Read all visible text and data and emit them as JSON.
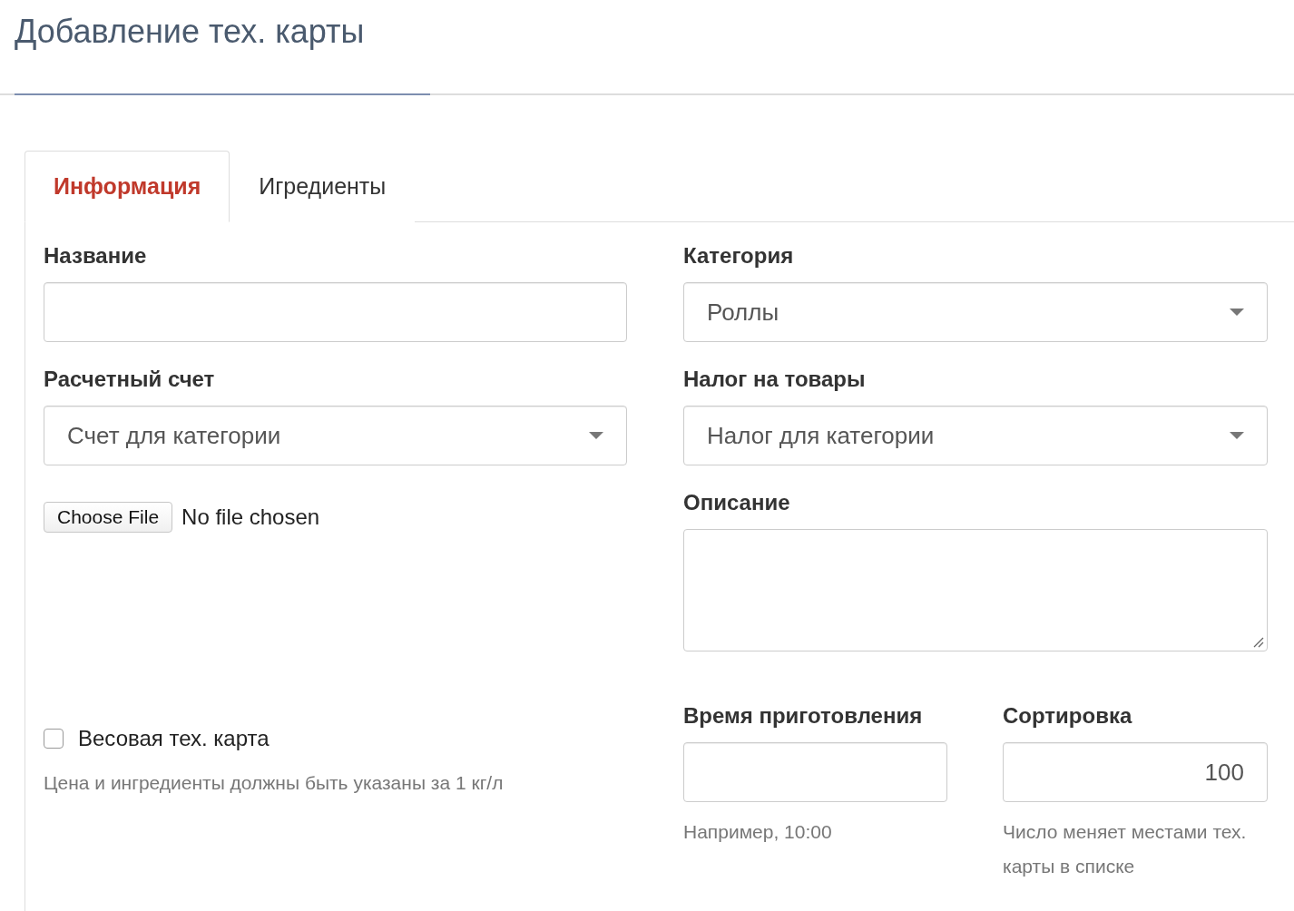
{
  "page_title": "Добавление тех. карты",
  "tabs": [
    {
      "label": "Информация",
      "selected": true
    },
    {
      "label": "Игредиенты",
      "selected": false
    }
  ],
  "name_field": {
    "label": "Название"
  },
  "category_field": {
    "label": "Категория",
    "value": "Роллы"
  },
  "account_field": {
    "label": "Расчетный счет",
    "value": "Счет для категории"
  },
  "tax_field": {
    "label": "Налог на товары",
    "value": "Налог для категории"
  },
  "file_input": {
    "button": "Choose File",
    "status": "No file chosen"
  },
  "description_field": {
    "label": "Описание"
  },
  "weight_checkbox": {
    "label": "Весовая тех. карта",
    "checked": false,
    "help": "Цена и ингредиенты должны быть указаны за 1 кг/л"
  },
  "cooking_time_field": {
    "label": "Время приготовления",
    "help": "Например, 10:00"
  },
  "sort_field": {
    "label": "Сортировка",
    "value": "100",
    "help": "Число меняет местами тех. карты в списке"
  }
}
